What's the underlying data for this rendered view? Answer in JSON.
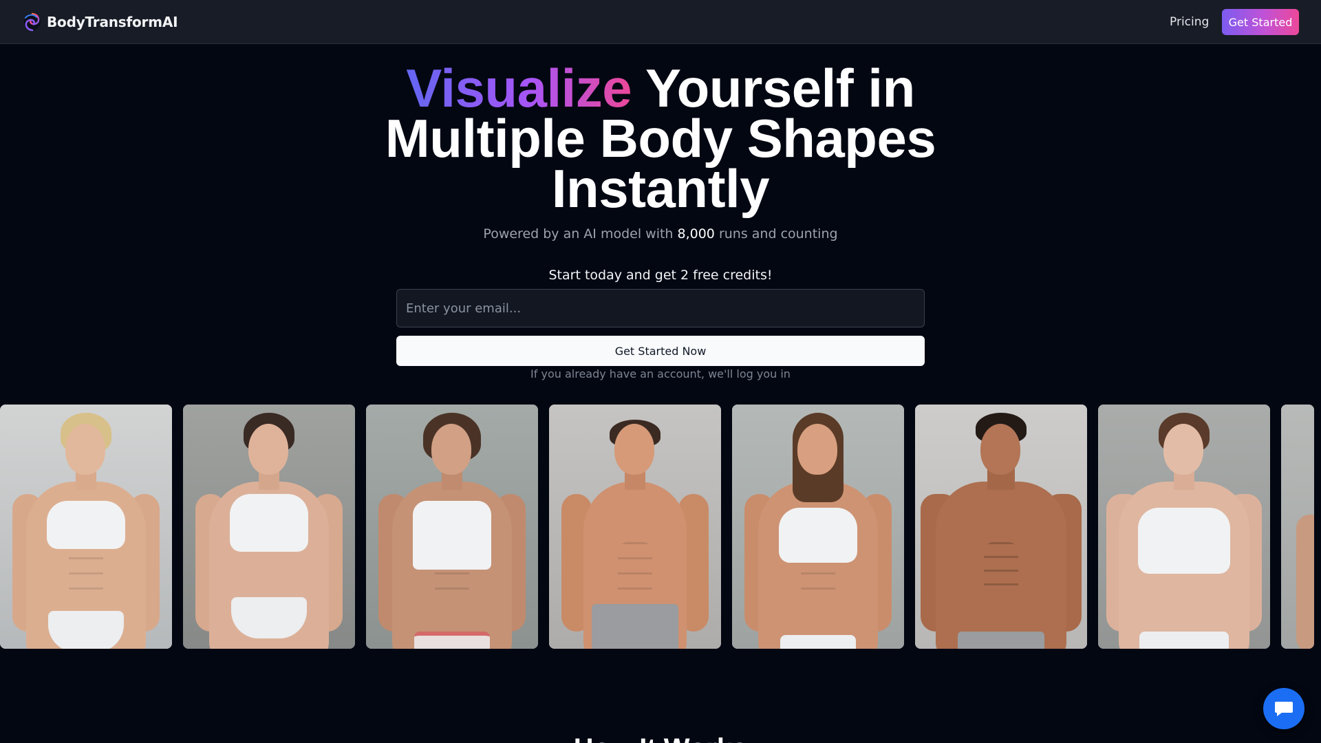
{
  "header": {
    "brand": "BodyTransformAI",
    "nav_pricing": "Pricing",
    "cta_label": "Get Started"
  },
  "hero": {
    "title_accent": "Visualize",
    "title_rest": " Yourself in Multiple Body Shapes Instantly",
    "subtitle_prefix": "Powered by an AI model with ",
    "runs_count": "8,000",
    "subtitle_suffix": " runs and counting",
    "promo": "Start today and get 2 free credits!",
    "email_placeholder": "Enter your email...",
    "email_value": "",
    "submit_label": "Get Started Now",
    "login_note": "If you already have an account, we'll log you in"
  },
  "gallery": {
    "images": [
      {
        "name": "gallery-image-1",
        "subject": "woman-white-bikini-blonde"
      },
      {
        "name": "gallery-image-2",
        "subject": "woman-white-bikini-dark-hair"
      },
      {
        "name": "gallery-image-3",
        "subject": "woman-white-crop-top-short-hair"
      },
      {
        "name": "gallery-image-4",
        "subject": "man-shirtless-grey-sweatpants"
      },
      {
        "name": "gallery-image-5",
        "subject": "woman-white-crop-top-long-hair"
      },
      {
        "name": "gallery-image-6",
        "subject": "man-shirtless-muscular"
      },
      {
        "name": "gallery-image-7",
        "subject": "woman-white-sports-bra-curvy"
      },
      {
        "name": "gallery-image-8",
        "subject": "partial-image"
      }
    ]
  },
  "next_section": {
    "heading": "How It Works"
  },
  "colors": {
    "background": "#030712",
    "header": "#181c26",
    "gradient_start": "#6366f1",
    "gradient_end": "#ec4899",
    "chat_button": "#1b6ef3"
  },
  "icons": {
    "logo": "swirl-logo-icon",
    "chat": "chat-bubble-icon"
  }
}
